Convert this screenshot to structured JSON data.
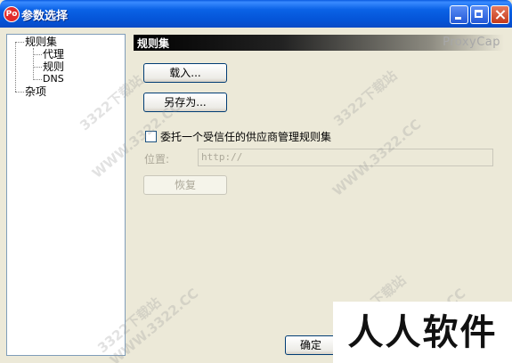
{
  "window": {
    "title": "参数选择",
    "icon_label": "Po"
  },
  "tree": {
    "items": [
      {
        "label": "规则集"
      },
      {
        "label": "代理"
      },
      {
        "label": "规则"
      },
      {
        "label": "DNS"
      },
      {
        "label": "杂项"
      }
    ]
  },
  "panel": {
    "title": "规则集",
    "brand": "ProxyCap",
    "load_button": "载入...",
    "saveas_button": "另存为...",
    "checkbox_label": "委托一个受信任的供应商管理规则集",
    "checkbox_checked": false,
    "location_label": "位置:",
    "location_value": "http://",
    "restore_button": "恢复"
  },
  "footer": {
    "ok_button": "确定"
  },
  "watermark": {
    "text_domain": "WWW.3322.CC",
    "text_site": "3322下载站",
    "corner_logo": "人人软件园"
  },
  "colors": {
    "titlebar": "#0A5BE0",
    "window_bg": "#ECE9D8",
    "panel_header": "#000000"
  }
}
